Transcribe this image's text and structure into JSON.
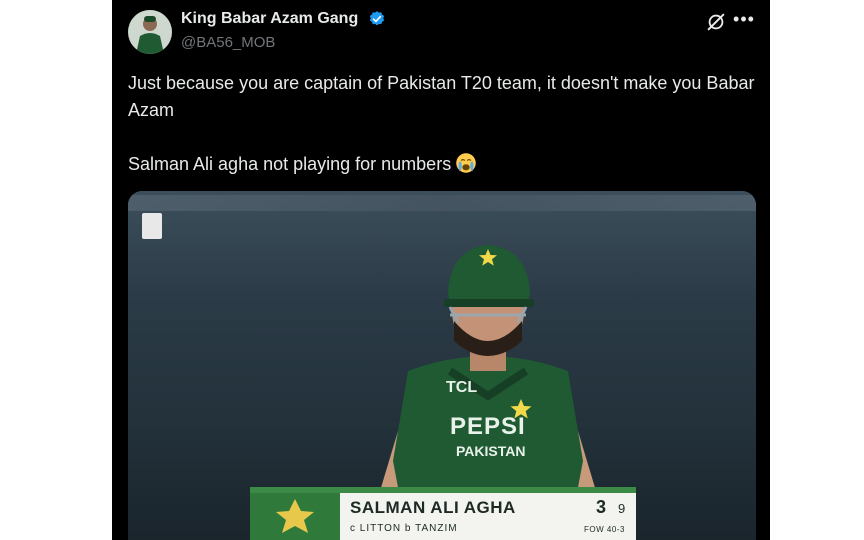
{
  "tweet": {
    "display_name": "King Babar Azam Gang",
    "handle": "@BA56_MOB",
    "text_line1": "Just because you are captain of Pakistan T20 team, it doesn't make you Babar Azam",
    "text_line2": "Salman Ali agha not playing for numbers",
    "emoji": "crying-face-emoji"
  },
  "media": {
    "scoreboard": {
      "player_name": "SALMAN ALI AGHA",
      "runs": "3",
      "balls": "9",
      "dismissal": "c  LITTON   b  TANZIM",
      "fall_of_wicket": "FOW 40-3"
    },
    "jersey_text": {
      "sponsor_top": "TCL",
      "sponsor_main": "PEPSI",
      "team": "PAKISTAN"
    }
  },
  "colors": {
    "background": "#000000",
    "text": "#e7e9ea",
    "muted": "#71767b",
    "verified": "#1d9bf0",
    "jersey": "#1f5a33",
    "scorebar_green": "#2f7a3a"
  }
}
